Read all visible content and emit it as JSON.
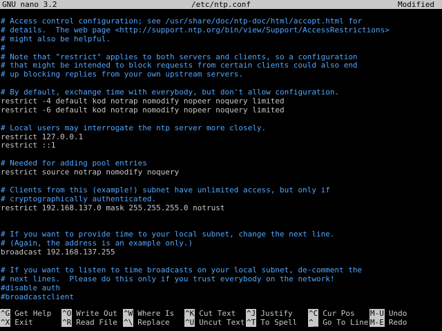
{
  "titlebar": {
    "app": "GNU nano 3.2",
    "file": "/etc/ntp.conf",
    "status": "Modified"
  },
  "editor": {
    "lines": [
      {
        "text": "# Access control configuration; see /usr/share/doc/ntp-doc/html/accopt.html for",
        "type": "comment"
      },
      {
        "text": "# details.  The web page <http://support.ntp.org/bin/view/Support/AccessRestrictions>",
        "type": "comment"
      },
      {
        "text": "# might also be helpful.",
        "type": "comment"
      },
      {
        "text": "#",
        "type": "comment"
      },
      {
        "text": "# Note that \"restrict\" applies to both servers and clients, so a configuration",
        "type": "comment"
      },
      {
        "text": "# that might be intended to block requests from certain clients could also end",
        "type": "comment"
      },
      {
        "text": "# up blocking replies from your own upstream servers.",
        "type": "comment"
      },
      {
        "text": "",
        "type": "code"
      },
      {
        "text": "# By default, exchange time with everybody, but don't allow configuration.",
        "type": "comment"
      },
      {
        "text": "restrict -4 default kod notrap nomodify nopeer noquery limited",
        "type": "code"
      },
      {
        "text": "restrict -6 default kod notrap nomodify nopeer noquery limited",
        "type": "code"
      },
      {
        "text": "",
        "type": "code"
      },
      {
        "text": "# Local users may interrogate the ntp server more closely.",
        "type": "comment"
      },
      {
        "text": "restrict 127.0.0.1",
        "type": "code"
      },
      {
        "text": "restrict ::1",
        "type": "code"
      },
      {
        "text": "",
        "type": "code"
      },
      {
        "text": "# Needed for adding pool entries",
        "type": "comment"
      },
      {
        "text": "restrict source notrap nomodify noquery",
        "type": "code"
      },
      {
        "text": "",
        "type": "code"
      },
      {
        "text": "# Clients from this (example!) subnet have unlimited access, but only if",
        "type": "comment"
      },
      {
        "text": "# cryptographically authenticated.",
        "type": "comment"
      },
      {
        "text": "restrict 192.168.137.0 mask 255.255.255.0 notrust",
        "type": "code"
      },
      {
        "text": "",
        "type": "code"
      },
      {
        "text": "",
        "type": "code"
      },
      {
        "text": "# If you want to provide time to your local subnet, change the next line.",
        "type": "comment"
      },
      {
        "text": "# (Again, the address is an example only.)",
        "type": "comment"
      },
      {
        "text": "broadcast 192.168.137.255",
        "type": "code"
      },
      {
        "text": "",
        "type": "code"
      },
      {
        "text": "# If you want to listen to time broadcasts on your local subnet, de-comment the",
        "type": "comment"
      },
      {
        "text": "# next lines.  Please do this only if you trust everybody on the network!",
        "type": "comment"
      },
      {
        "text": "#disable auth",
        "type": "comment"
      },
      {
        "text": "#broadcastclient",
        "type": "comment"
      }
    ]
  },
  "shortcuts": {
    "row1": [
      {
        "key": "^G",
        "label": "Get Help"
      },
      {
        "key": "^O",
        "label": "Write Out"
      },
      {
        "key": "^W",
        "label": "Where Is"
      },
      {
        "key": "^K",
        "label": "Cut Text"
      },
      {
        "key": "^J",
        "label": "Justify"
      },
      {
        "key": "^C",
        "label": "Cur Pos"
      },
      {
        "key": "M-U",
        "label": "Undo"
      }
    ],
    "row2": [
      {
        "key": "^X",
        "label": "Exit"
      },
      {
        "key": "^R",
        "label": "Read File"
      },
      {
        "key": "^\\",
        "label": "Replace"
      },
      {
        "key": "^U",
        "label": "Uncut Text"
      },
      {
        "key": "^T",
        "label": "To Spell"
      },
      {
        "key": "^_",
        "label": "Go To Line"
      },
      {
        "key": "M-E",
        "label": "Redo"
      }
    ]
  },
  "colors": {
    "comment": "#50a6ff",
    "text": "#c8c8c8",
    "inverse_bg": "#c8c8c8",
    "background": "#000000"
  }
}
